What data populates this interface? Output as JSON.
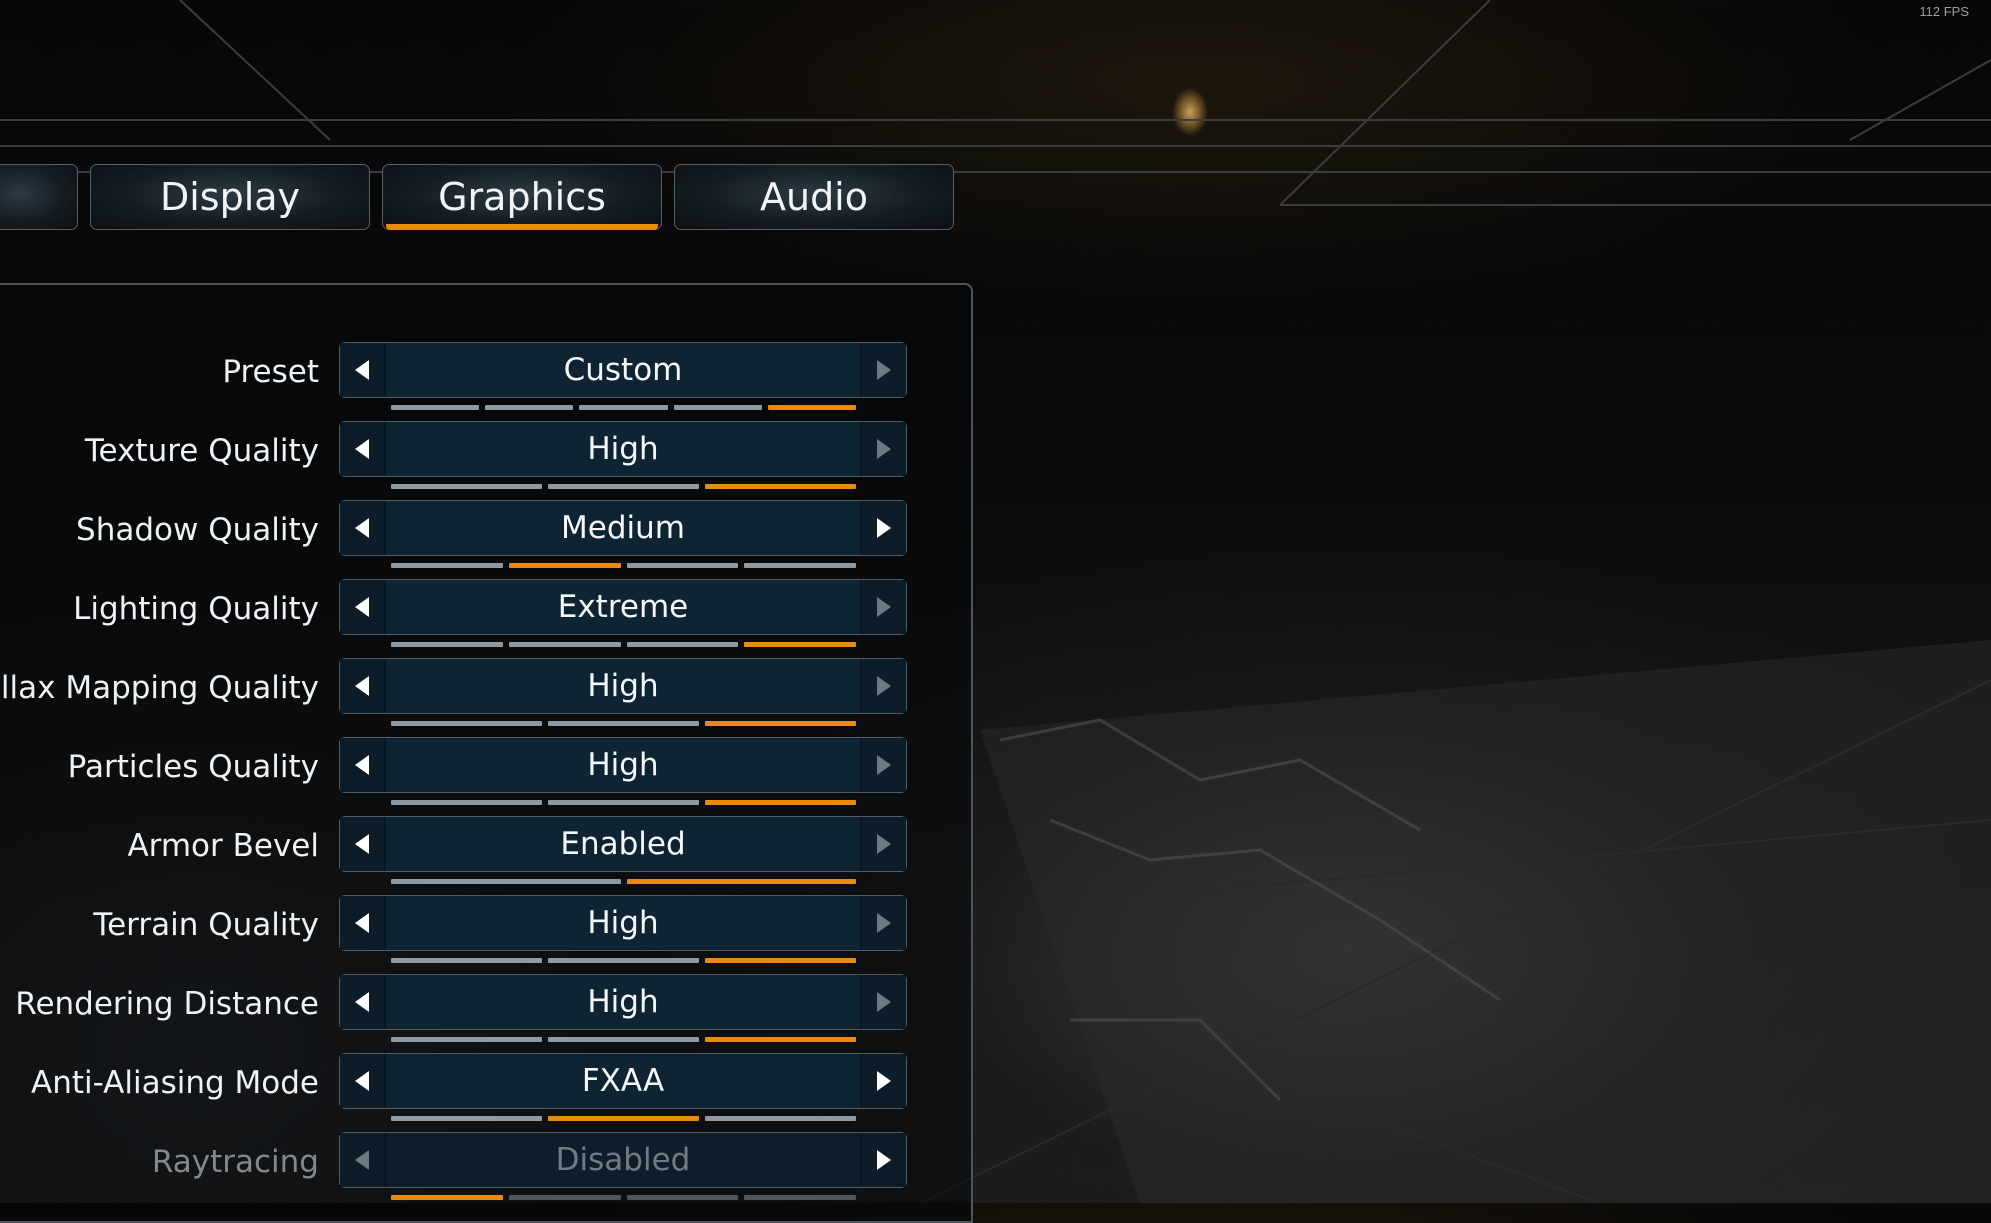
{
  "fps": "112 FPS",
  "tabs": [
    {
      "label": "",
      "active": false
    },
    {
      "label": "Display",
      "active": false
    },
    {
      "label": "Graphics",
      "active": true
    },
    {
      "label": "Audio",
      "active": false
    }
  ],
  "settings": [
    {
      "label": "Preset",
      "value": "Custom",
      "levels": 5,
      "selected": 4,
      "can_decrease": true,
      "can_increase": false,
      "disabled": false
    },
    {
      "label": "Texture Quality",
      "value": "High",
      "levels": 3,
      "selected": 2,
      "can_decrease": true,
      "can_increase": false,
      "disabled": false
    },
    {
      "label": "Shadow Quality",
      "value": "Medium",
      "levels": 4,
      "selected": 1,
      "can_decrease": true,
      "can_increase": true,
      "disabled": false
    },
    {
      "label": "Lighting Quality",
      "value": "Extreme",
      "levels": 4,
      "selected": 3,
      "can_decrease": true,
      "can_increase": false,
      "disabled": false
    },
    {
      "label": "allax Mapping Quality",
      "value": "High",
      "levels": 3,
      "selected": 2,
      "can_decrease": true,
      "can_increase": false,
      "disabled": false
    },
    {
      "label": "Particles Quality",
      "value": "High",
      "levels": 3,
      "selected": 2,
      "can_decrease": true,
      "can_increase": false,
      "disabled": false
    },
    {
      "label": "Armor Bevel",
      "value": "Enabled",
      "levels": 2,
      "selected": 1,
      "can_decrease": true,
      "can_increase": false,
      "disabled": false
    },
    {
      "label": "Terrain Quality",
      "value": "High",
      "levels": 3,
      "selected": 2,
      "can_decrease": true,
      "can_increase": false,
      "disabled": false
    },
    {
      "label": "Rendering Distance",
      "value": "High",
      "levels": 3,
      "selected": 2,
      "can_decrease": true,
      "can_increase": false,
      "disabled": false
    },
    {
      "label": "Anti-Aliasing Mode",
      "value": "FXAA",
      "levels": 3,
      "selected": 1,
      "can_decrease": true,
      "can_increase": true,
      "disabled": false
    },
    {
      "label": "Raytracing",
      "value": "Disabled",
      "levels": 4,
      "selected": 0,
      "can_decrease": false,
      "can_increase": true,
      "disabled": true
    }
  ],
  "colors": {
    "accent": "#e88b0b",
    "selector_bg": "#0f2433",
    "segment_inactive": "#8f9ba4"
  }
}
